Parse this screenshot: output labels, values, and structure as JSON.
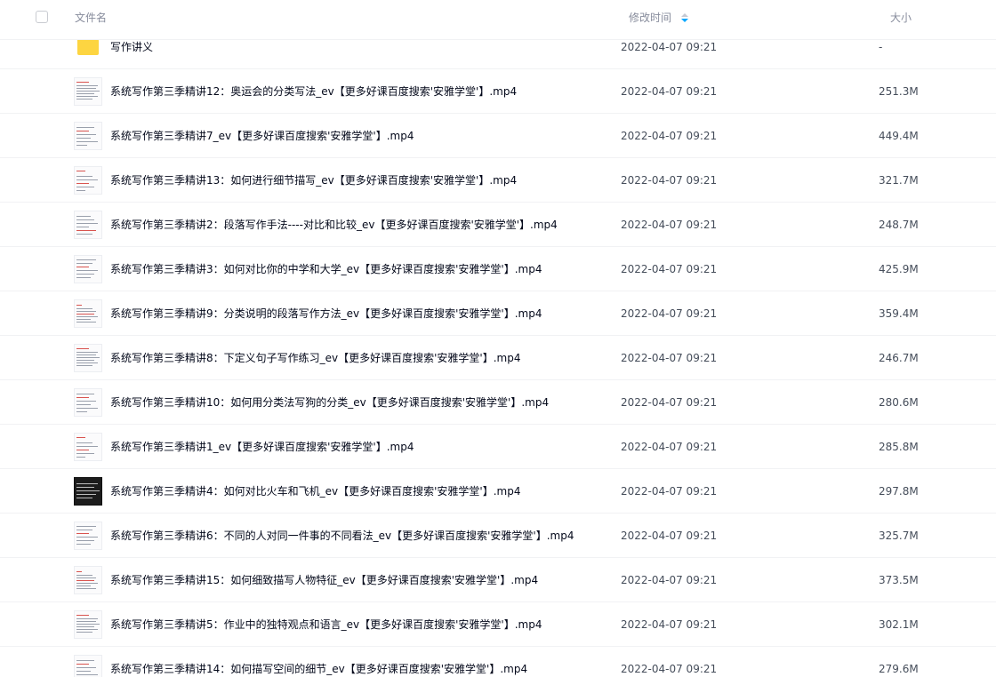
{
  "header": {
    "name_label": "文件名",
    "time_label": "修改时间",
    "size_label": "大小"
  },
  "colors": {
    "sort_active": "#06a7ff",
    "folder": "#fdd541",
    "header_text": "#878c9c"
  },
  "files": [
    {
      "icon": "folder-icon",
      "name": "写作讲义",
      "time": "2022-04-07 09:21",
      "size": "-"
    },
    {
      "icon": "video-thumbnail",
      "name": "系统写作第三季精讲12：奥运会的分类写法_ev【更多好课百度搜索'安雅学堂'】.mp4",
      "time": "2022-04-07 09:21",
      "size": "251.3M"
    },
    {
      "icon": "video-thumbnail",
      "name": "系统写作第三季精讲7_ev【更多好课百度搜索'安雅学堂'】.mp4",
      "time": "2022-04-07 09:21",
      "size": "449.4M"
    },
    {
      "icon": "video-thumbnail",
      "name": "系统写作第三季精讲13：如何进行细节描写_ev【更多好课百度搜索'安雅学堂'】.mp4",
      "time": "2022-04-07 09:21",
      "size": "321.7M"
    },
    {
      "icon": "video-thumbnail",
      "name": "系统写作第三季精讲2：段落写作手法----对比和比较_ev【更多好课百度搜索'安雅学堂'】.mp4",
      "time": "2022-04-07 09:21",
      "size": "248.7M"
    },
    {
      "icon": "video-thumbnail",
      "name": "系统写作第三季精讲3：如何对比你的中学和大学_ev【更多好课百度搜索'安雅学堂'】.mp4",
      "time": "2022-04-07 09:21",
      "size": "425.9M"
    },
    {
      "icon": "video-thumbnail",
      "name": "系统写作第三季精讲9：分类说明的段落写作方法_ev【更多好课百度搜索'安雅学堂'】.mp4",
      "time": "2022-04-07 09:21",
      "size": "359.4M"
    },
    {
      "icon": "video-thumbnail",
      "name": "系统写作第三季精讲8：下定义句子写作练习_ev【更多好课百度搜索'安雅学堂'】.mp4",
      "time": "2022-04-07 09:21",
      "size": "246.7M"
    },
    {
      "icon": "video-thumbnail",
      "name": "系统写作第三季精讲10：如何用分类法写狗的分类_ev【更多好课百度搜索'安雅学堂'】.mp4",
      "time": "2022-04-07 09:21",
      "size": "280.6M"
    },
    {
      "icon": "video-thumbnail",
      "name": "系统写作第三季精讲1_ev【更多好课百度搜索'安雅学堂'】.mp4",
      "time": "2022-04-07 09:21",
      "size": "285.8M"
    },
    {
      "icon": "video-thumbnail-dark",
      "name": "系统写作第三季精讲4：如何对比火车和飞机_ev【更多好课百度搜索'安雅学堂'】.mp4",
      "time": "2022-04-07 09:21",
      "size": "297.8M"
    },
    {
      "icon": "video-thumbnail",
      "name": "系统写作第三季精讲6：不同的人对同一件事的不同看法_ev【更多好课百度搜索'安雅学堂'】.mp4",
      "time": "2022-04-07 09:21",
      "size": "325.7M"
    },
    {
      "icon": "video-thumbnail",
      "name": "系统写作第三季精讲15：如何细致描写人物特征_ev【更多好课百度搜索'安雅学堂'】.mp4",
      "time": "2022-04-07 09:21",
      "size": "373.5M"
    },
    {
      "icon": "video-thumbnail",
      "name": "系统写作第三季精讲5：作业中的独特观点和语言_ev【更多好课百度搜索'安雅学堂'】.mp4",
      "time": "2022-04-07 09:21",
      "size": "302.1M"
    },
    {
      "icon": "video-thumbnail",
      "name": "系统写作第三季精讲14：如何描写空间的细节_ev【更多好课百度搜索'安雅学堂'】.mp4",
      "time": "2022-04-07 09:21",
      "size": "279.6M"
    }
  ]
}
